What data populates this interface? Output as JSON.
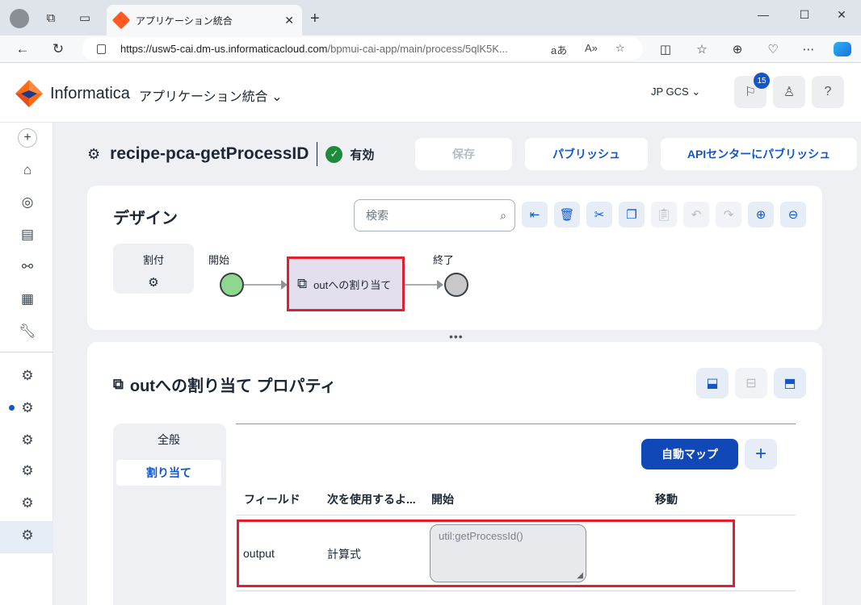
{
  "browser": {
    "tab_title": "アプリケーション統合",
    "url_host": "https://usw5-cai.dm-us.informaticacloud.com",
    "url_path": "/bpmui-cai-app/main/process/5qlK5K..."
  },
  "header": {
    "brand": "Informatica",
    "app_name": "アプリケーション統合",
    "org": "JP GCS",
    "notification_count": "15"
  },
  "process": {
    "name": "recipe-pca-getProcessID",
    "status": "有効",
    "save_label": "保存",
    "publish_label": "パブリッシュ",
    "api_publish_label": "APIセンターにパブリッシュ"
  },
  "design": {
    "title": "デザイン",
    "search_placeholder": "検索",
    "attach_label": "割付",
    "start_label": "開始",
    "assign_label": "outへの割り当て",
    "end_label": "終了"
  },
  "properties": {
    "title": "outへの割り当て プロパティ",
    "tabs": [
      "全般",
      "割り当て"
    ],
    "auto_map_label": "自動マップ",
    "columns": [
      "フィールド",
      "次を使用するよ...",
      "開始",
      "移動"
    ],
    "rows": [
      {
        "field": "output",
        "using": "計算式",
        "from": "util:getProcessId()"
      }
    ]
  },
  "colors": {
    "accent": "#1456c8",
    "highlight": "#e0202c",
    "start_node": "#8fd68e",
    "end_node": "#c8c8c8"
  }
}
